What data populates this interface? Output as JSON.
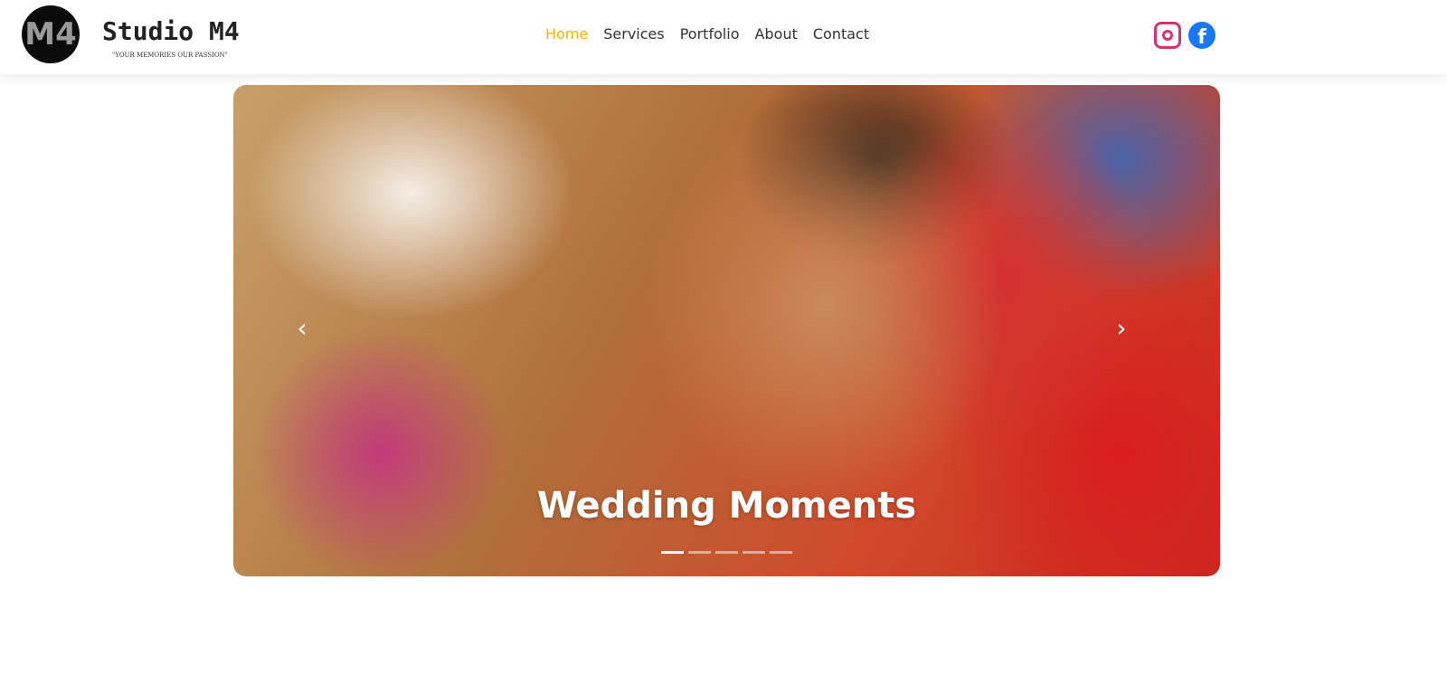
{
  "header": {
    "logo_text": "M4",
    "brand": "Studio M4",
    "tagline": "\"YOUR MEMORIES OUR PASSION\"",
    "nav": [
      {
        "label": "Home",
        "active": true
      },
      {
        "label": "Services"
      },
      {
        "label": "Portfolio"
      },
      {
        "label": "About"
      },
      {
        "label": "Contact"
      }
    ],
    "social": [
      {
        "icon": "instagram-icon"
      },
      {
        "icon": "facebook-icon",
        "glyph": "f"
      }
    ],
    "active_color": "#f2b705"
  },
  "carousel": {
    "caption": "Wedding Moments",
    "prev": "‹",
    "next": "›",
    "slide_count": 5,
    "active_index": 0
  }
}
